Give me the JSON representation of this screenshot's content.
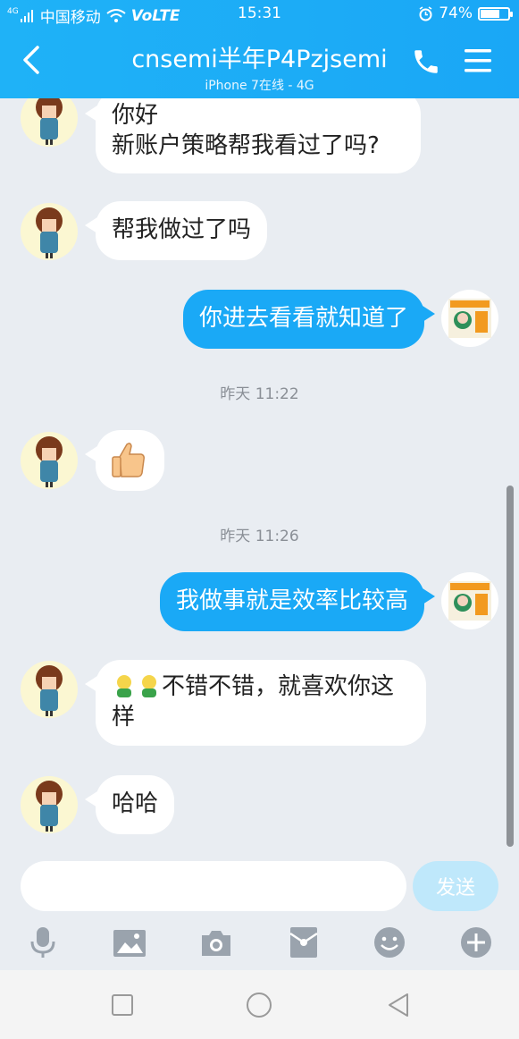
{
  "status_bar": {
    "network": "4G",
    "carrier": "中国移动",
    "volte": "VoLTE",
    "time": "15:31",
    "battery": "74%",
    "battery_level": 0.74
  },
  "header": {
    "title": "cnsemi半年P4Pzjsemi",
    "subtitle": "iPhone 7在线 - 4G"
  },
  "messages": [
    {
      "side": "in",
      "text_lines": [
        "你好",
        "新账户策略帮我看过了吗?"
      ]
    },
    {
      "side": "in",
      "text": "帮我做过了吗"
    },
    {
      "side": "out",
      "text": "你进去看看就知道了"
    },
    {
      "timestamp": "昨天 11:22"
    },
    {
      "side": "in",
      "emoji": "thumbs-up"
    },
    {
      "timestamp": "昨天 11:26"
    },
    {
      "side": "out",
      "text": "我做事就是效率比较高"
    },
    {
      "side": "in",
      "text_lines": [
        "不错不错，就喜欢你这",
        "样"
      ]
    },
    {
      "side": "in",
      "text": "哈哈"
    }
  ],
  "input": {
    "placeholder": "",
    "value": "",
    "send_label": "发送"
  },
  "toolbar": {
    "items": [
      "microphone-icon",
      "image-icon",
      "camera-icon",
      "red-packet-icon",
      "emoji-icon",
      "plus-icon"
    ]
  },
  "nav": {
    "items": [
      "recents-icon",
      "home-icon",
      "back-icon"
    ]
  },
  "colors": {
    "header": "#1fb2f7",
    "outgoing_bubble": "#1aa9f6",
    "incoming_bubble": "#ffffff",
    "background": "#e9edf2",
    "send_disabled": "#bfe8fb"
  }
}
